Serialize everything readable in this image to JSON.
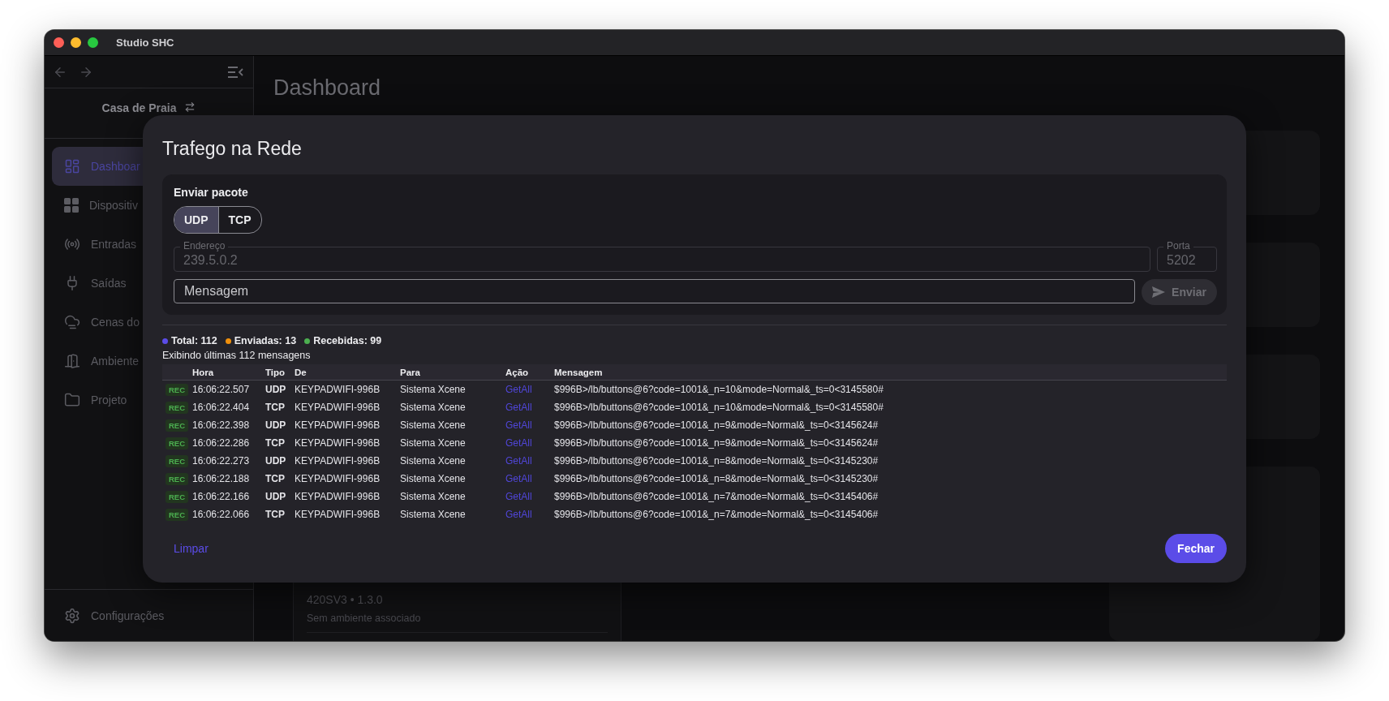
{
  "window": {
    "title": "Studio SHC"
  },
  "sidebar": {
    "context": "Casa de Praia",
    "items": [
      {
        "kind": "dashboard",
        "label": "Dashboar",
        "selected": true
      },
      {
        "kind": "devices",
        "label": "Dispositiv",
        "selected": false
      },
      {
        "kind": "inputs",
        "label": "Entradas",
        "selected": false
      },
      {
        "kind": "outputs",
        "label": "Saídas",
        "selected": false
      },
      {
        "kind": "scenes",
        "label": "Cenas do",
        "selected": false
      },
      {
        "kind": "rooms",
        "label": "Ambiente",
        "selected": false
      },
      {
        "kind": "project",
        "label": "Projeto",
        "selected": false
      }
    ],
    "footer": "Configurações"
  },
  "main": {
    "title": "Dashboard",
    "device": {
      "model": "420SV3 • 1.3.0",
      "room": "Sem ambiente associado"
    }
  },
  "dialog": {
    "title": "Trafego na Rede",
    "send": {
      "heading": "Enviar pacote",
      "protocols": [
        {
          "label": "UDP",
          "selected": true
        },
        {
          "label": "TCP",
          "selected": false
        }
      ],
      "address": {
        "label": "Endereço",
        "value": "239.5.0.2"
      },
      "port": {
        "label": "Porta",
        "value": "5202"
      },
      "message": {
        "placeholder": "Mensagem"
      },
      "send_button": {
        "label": "Enviar",
        "disabled": true
      }
    },
    "stats": [
      {
        "label": "Total: 112",
        "color": "#5b4ce8"
      },
      {
        "label": "Enviadas: 13",
        "color": "#f0900c"
      },
      {
        "label": "Recebidas: 99",
        "color": "#4caf50"
      }
    ],
    "caption": "Exibindo últimas 112 mensagens",
    "table": {
      "columns": [
        "Hora",
        "Tipo",
        "De",
        "Para",
        "Ação",
        "Mensagem"
      ],
      "rows": [
        {
          "badge": "REC",
          "time": "16:06:22.507",
          "type": "UDP",
          "from": "KEYPADWIFI-996B",
          "to": "Sistema Xcene",
          "action": "GetAll",
          "message": "$996B>/lb/buttons@6?code=1001&_n=10&mode=Normal&_ts=0<3145580#"
        },
        {
          "badge": "REC",
          "time": "16:06:22.404",
          "type": "TCP",
          "from": "KEYPADWIFI-996B",
          "to": "Sistema Xcene",
          "action": "GetAll",
          "message": "$996B>/lb/buttons@6?code=1001&_n=10&mode=Normal&_ts=0<3145580#"
        },
        {
          "badge": "REC",
          "time": "16:06:22.398",
          "type": "UDP",
          "from": "KEYPADWIFI-996B",
          "to": "Sistema Xcene",
          "action": "GetAll",
          "message": "$996B>/lb/buttons@6?code=1001&_n=9&mode=Normal&_ts=0<3145624#"
        },
        {
          "badge": "REC",
          "time": "16:06:22.286",
          "type": "TCP",
          "from": "KEYPADWIFI-996B",
          "to": "Sistema Xcene",
          "action": "GetAll",
          "message": "$996B>/lb/buttons@6?code=1001&_n=9&mode=Normal&_ts=0<3145624#"
        },
        {
          "badge": "REC",
          "time": "16:06:22.273",
          "type": "UDP",
          "from": "KEYPADWIFI-996B",
          "to": "Sistema Xcene",
          "action": "GetAll",
          "message": "$996B>/lb/buttons@6?code=1001&_n=8&mode=Normal&_ts=0<3145230#"
        },
        {
          "badge": "REC",
          "time": "16:06:22.188",
          "type": "TCP",
          "from": "KEYPADWIFI-996B",
          "to": "Sistema Xcene",
          "action": "GetAll",
          "message": "$996B>/lb/buttons@6?code=1001&_n=8&mode=Normal&_ts=0<3145230#"
        },
        {
          "badge": "REC",
          "time": "16:06:22.166",
          "type": "UDP",
          "from": "KEYPADWIFI-996B",
          "to": "Sistema Xcene",
          "action": "GetAll",
          "message": "$996B>/lb/buttons@6?code=1001&_n=7&mode=Normal&_ts=0<3145406#"
        },
        {
          "badge": "REC",
          "time": "16:06:22.066",
          "type": "TCP",
          "from": "KEYPADWIFI-996B",
          "to": "Sistema Xcene",
          "action": "GetAll",
          "message": "$996B>/lb/buttons@6?code=1001&_n=7&mode=Normal&_ts=0<3145406#"
        }
      ]
    },
    "clear": "Limpar",
    "close": "Fechar"
  }
}
